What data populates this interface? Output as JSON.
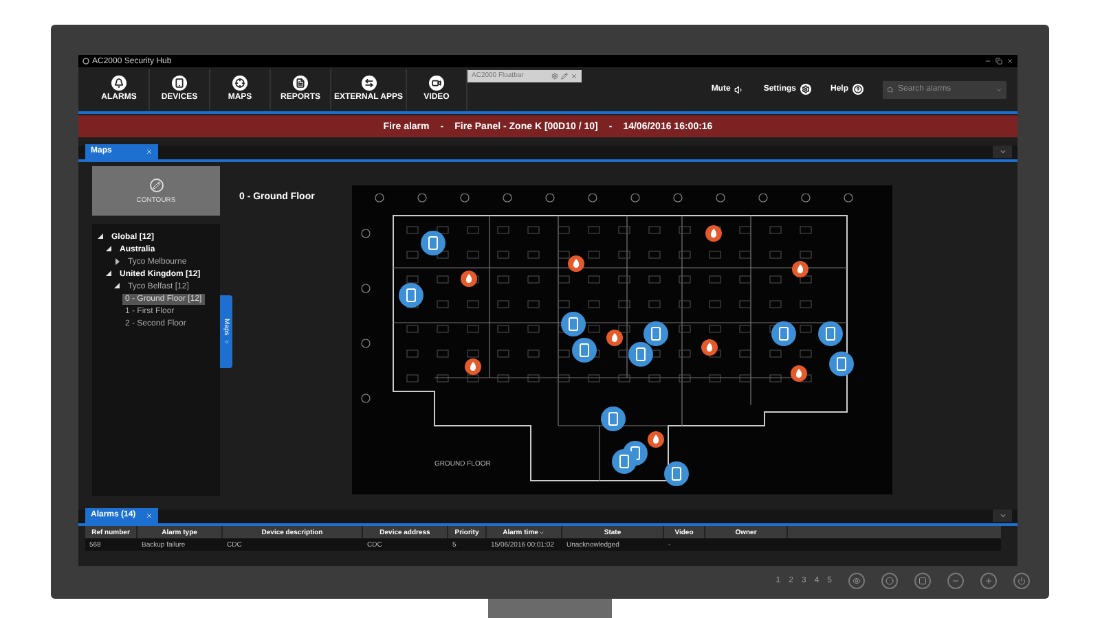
{
  "window": {
    "title": "AC2000 Security Hub"
  },
  "nav": [
    {
      "label": "ALARMS"
    },
    {
      "label": "DEVICES"
    },
    {
      "label": "MAPS"
    },
    {
      "label": "REPORTS"
    },
    {
      "label": "EXTERNAL APPS"
    },
    {
      "label": "VIDEO"
    }
  ],
  "floatbar": {
    "title": "AC2000 Floatbar"
  },
  "toolbar_right": [
    {
      "label": "Mute"
    },
    {
      "label": "Settings"
    },
    {
      "label": "Help"
    }
  ],
  "search": {
    "placeholder": "Search alarms"
  },
  "banner": {
    "parts": [
      "Fire alarm",
      "-",
      "Fire Panel - Zone K [00D10 / 10]",
      "-",
      "14/06/2016 16:00:16"
    ]
  },
  "maps_tab": {
    "label": "Maps"
  },
  "contours": {
    "label": "CONTOURS"
  },
  "tree": [
    {
      "label": "Global [12]",
      "expanded": true,
      "selected": false,
      "children": [
        {
          "label": "Australia",
          "expanded": true,
          "selected": false,
          "children": [
            {
              "label": "Tyco Melbourne",
              "expanded": false,
              "selected": false
            }
          ]
        },
        {
          "label": "United Kingdom [12]",
          "expanded": true,
          "selected": false,
          "children": [
            {
              "label": "Tyco Belfast [12]",
              "expanded": true,
              "selected": false,
              "children": [
                {
                  "label": "0 - Ground Floor [12]",
                  "selected": true
                },
                {
                  "label": "1 - First Floor",
                  "selected": false
                },
                {
                  "label": "2 - Second Floor",
                  "selected": false
                }
              ]
            }
          ]
        }
      ]
    }
  ],
  "side_tab": {
    "label": "Maps"
  },
  "map": {
    "title": "0 - Ground Floor",
    "plan_label": "GROUND FLOOR"
  },
  "alarms_tab": {
    "label": "Alarms (14)"
  },
  "table": {
    "columns": [
      {
        "label": "Ref number",
        "sorted": false
      },
      {
        "label": "Alarm type",
        "sorted": false
      },
      {
        "label": "Device description",
        "sorted": false
      },
      {
        "label": "Device address",
        "sorted": false
      },
      {
        "label": "Priority",
        "sorted": false
      },
      {
        "label": "Alarm time",
        "sorted": true
      },
      {
        "label": "State",
        "sorted": false
      },
      {
        "label": "Video",
        "sorted": false
      },
      {
        "label": "Owner",
        "sorted": false
      }
    ],
    "rows": [
      [
        "568",
        "Backup failure",
        "CDC",
        "CDC",
        "5",
        "15/06/2016 00:01:02",
        "Unacknowledged",
        "-",
        ""
      ]
    ]
  },
  "monitor": {
    "numbers": [
      "1",
      "2",
      "3",
      "4",
      "5"
    ]
  }
}
